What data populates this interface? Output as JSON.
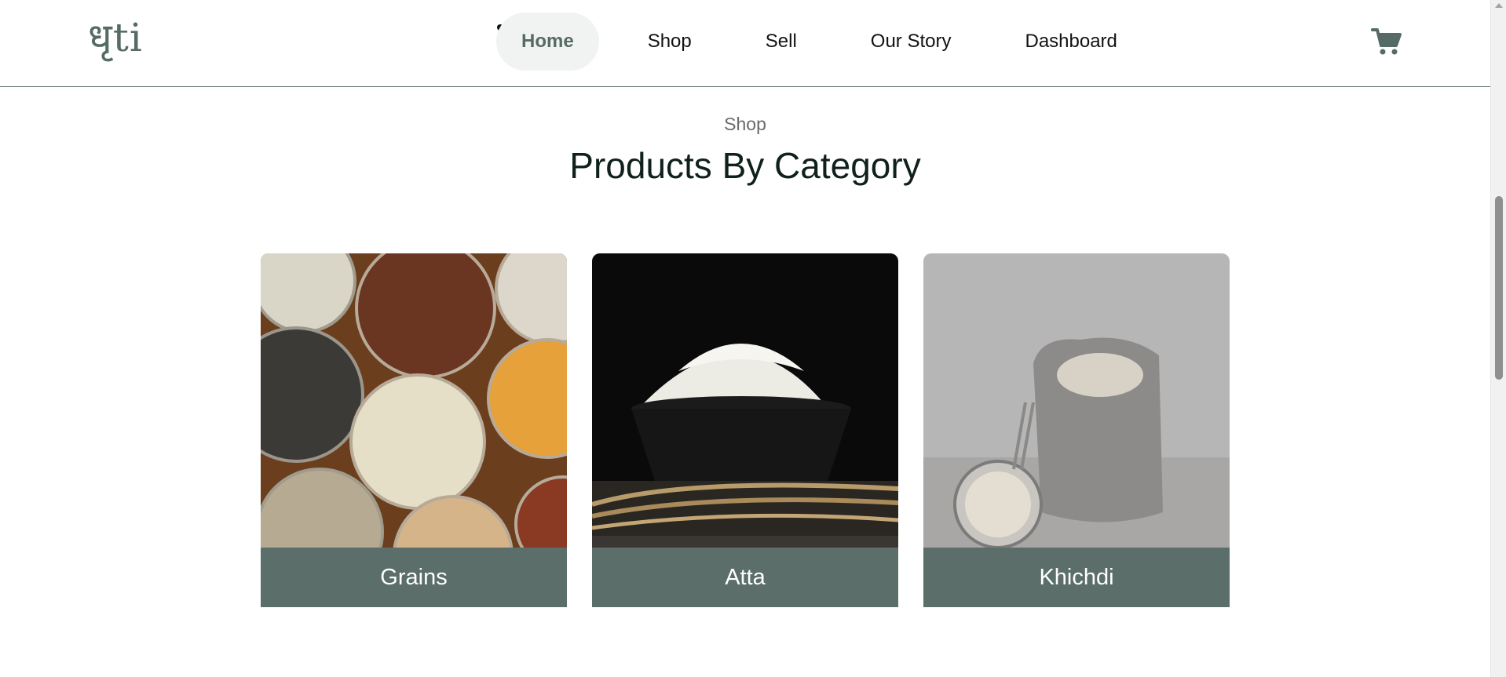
{
  "header": {
    "logo_text": "धृti",
    "nav": [
      {
        "label": "Home",
        "active": true
      },
      {
        "label": "Shop",
        "active": false
      },
      {
        "label": "Sell",
        "active": false
      },
      {
        "label": "Our Story",
        "active": false
      },
      {
        "label": "Dashboard",
        "active": false
      }
    ],
    "cart_icon": "cart-icon"
  },
  "section": {
    "eyebrow": "Shop",
    "title": "Products By Category"
  },
  "categories": [
    {
      "name": "Grains",
      "image": "grains-bowls-image"
    },
    {
      "name": "Atta",
      "image": "flour-bowl-image"
    },
    {
      "name": "Khichdi",
      "image": "flour-sack-image"
    }
  ],
  "colors": {
    "brand": "#5b6e69",
    "active_bg": "#f0f3f2"
  }
}
